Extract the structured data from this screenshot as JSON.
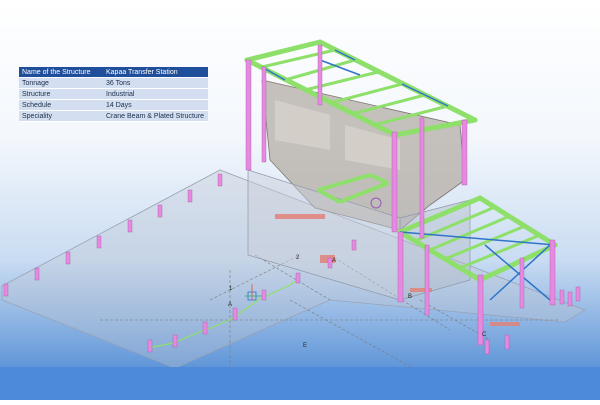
{
  "info_table": {
    "header": {
      "label": "Name of the Structure",
      "value": "Kapaa Transfer Station"
    },
    "rows": [
      {
        "label": "Tonnage",
        "value": "36 Tons"
      },
      {
        "label": "Structure",
        "value": "Industrial"
      },
      {
        "label": "Schedule",
        "value": "14 Days"
      },
      {
        "label": "Speciality",
        "value": "Crane Beam & Plated Structure"
      }
    ]
  },
  "grid_labels": {
    "a1": "A",
    "a2": "A",
    "b": "B",
    "c": "C",
    "e": "E",
    "n1": "1",
    "n2": "2"
  },
  "colors": {
    "beam": "#8ee06b",
    "column": "#e58ae0",
    "wall": "#b8b1aa",
    "brace": "#2e74c9",
    "gridline": "#7a7a7a",
    "slab": "#c0c6d2"
  }
}
